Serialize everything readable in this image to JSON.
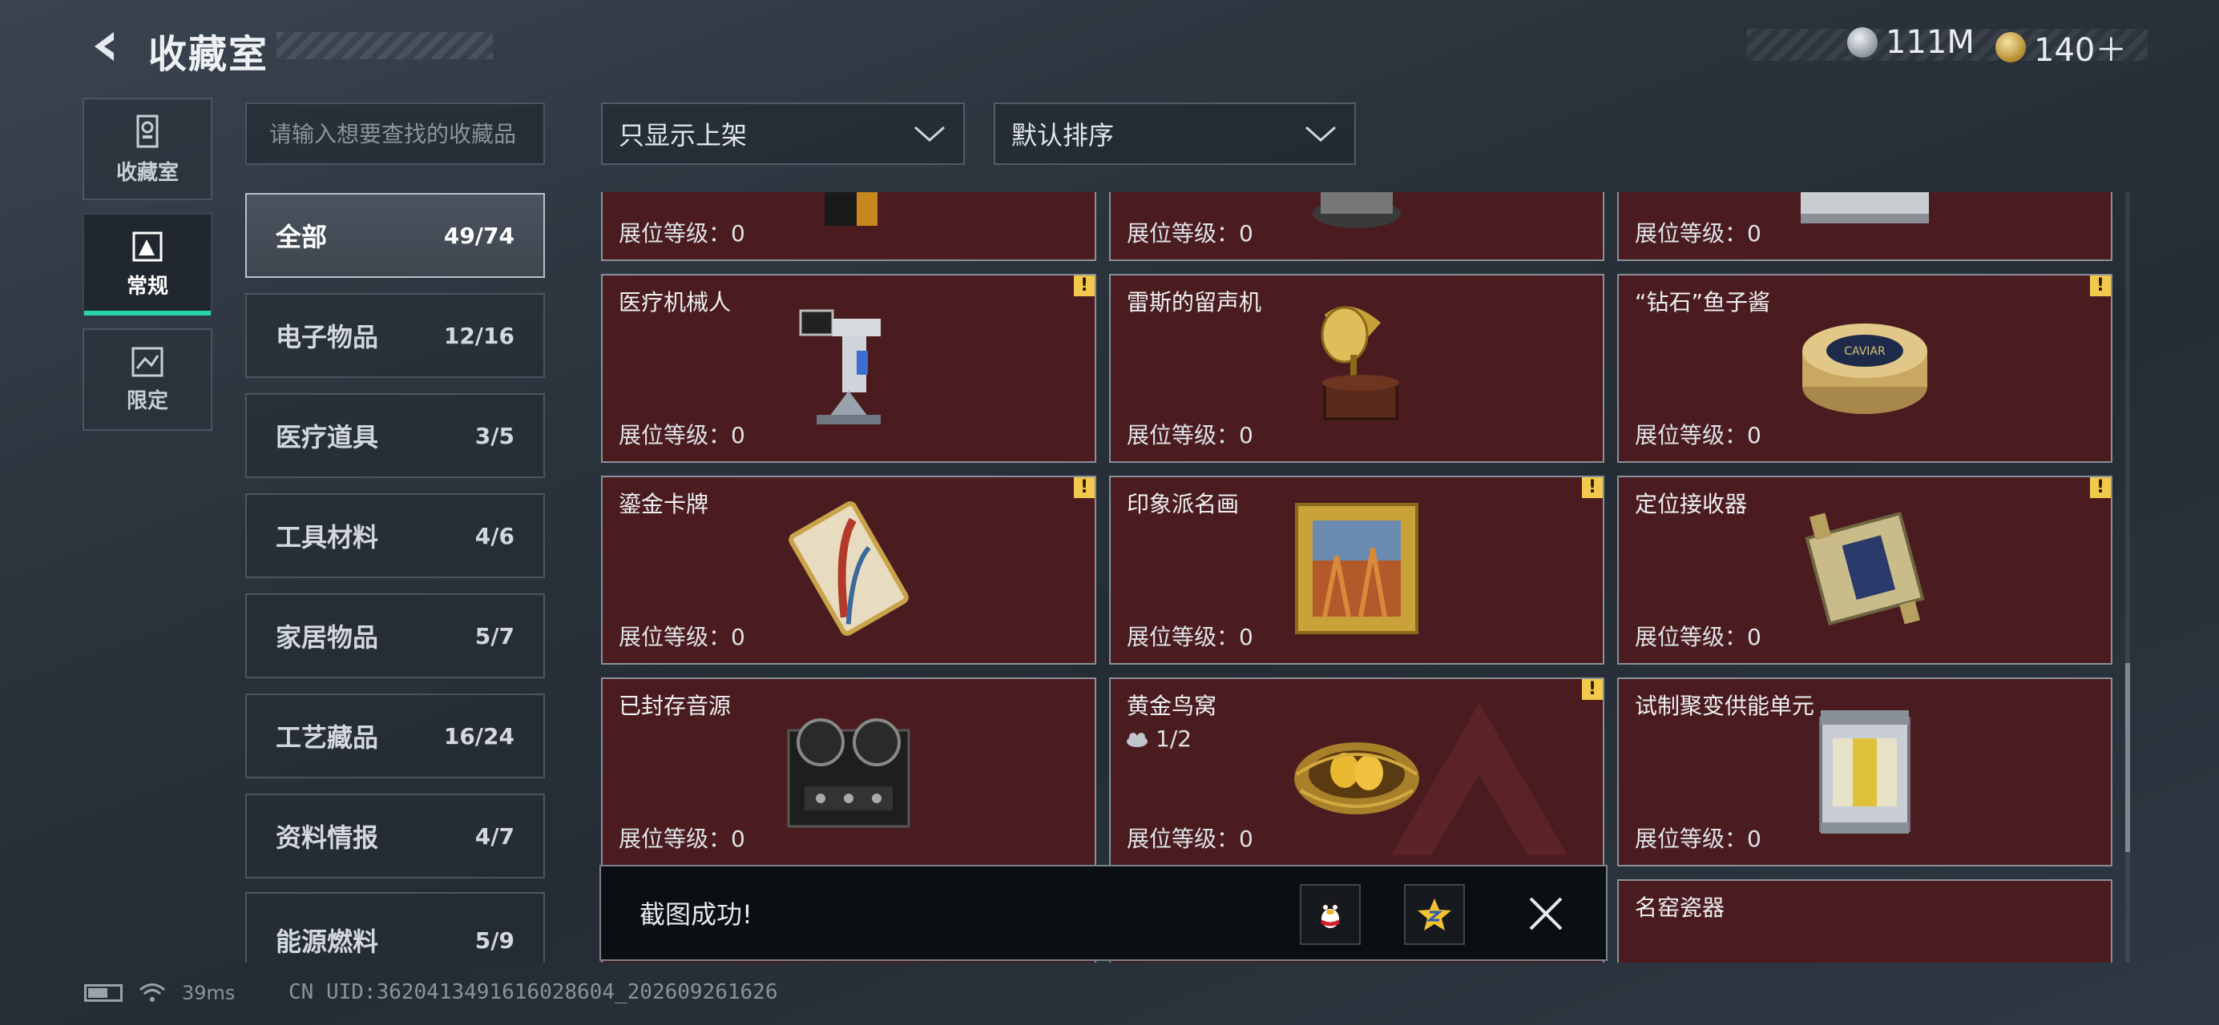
{
  "header": {
    "title": "收藏室",
    "currency1_value": "111M",
    "currency2_value": "140＋"
  },
  "side_tabs": [
    {
      "label": "收藏室",
      "icon": "trash-can-icon"
    },
    {
      "label": "常规",
      "icon": "document-icon"
    },
    {
      "label": "限定",
      "icon": "landscape-icon"
    }
  ],
  "search": {
    "placeholder": "请输入想要查找的收藏品"
  },
  "filters": {
    "display_filter": "只显示上架",
    "sort": "默认排序"
  },
  "categories": [
    {
      "label": "全部",
      "count": "49/74"
    },
    {
      "label": "电子物品",
      "count": "12/16"
    },
    {
      "label": "医疗道具",
      "count": "3/5"
    },
    {
      "label": "工具材料",
      "count": "4/6"
    },
    {
      "label": "家居物品",
      "count": "5/7"
    },
    {
      "label": "工艺藏品",
      "count": "16/24"
    },
    {
      "label": "资料情报",
      "count": "4/7"
    },
    {
      "label": "能源燃料",
      "count": "5/9"
    }
  ],
  "level_label": "展位等级：0",
  "items": [
    {
      "name": "",
      "warn": false
    },
    {
      "name": "",
      "warn": false
    },
    {
      "name": "",
      "warn": false
    },
    {
      "name": "医疗机械人",
      "warn": true
    },
    {
      "name": "雷斯的留声机",
      "warn": false
    },
    {
      "name": "“钻石”鱼子酱",
      "warn": true
    },
    {
      "name": "鎏金卡牌",
      "warn": true
    },
    {
      "name": "印象派名画",
      "warn": true
    },
    {
      "name": "定位接收器",
      "warn": true
    },
    {
      "name": "已封存音源",
      "warn": false
    },
    {
      "name": "黄金鸟窝",
      "warn": true,
      "sub": "1/2"
    },
    {
      "name": "试制聚变供能单元",
      "warn": false
    },
    {
      "name": "",
      "warn": false
    },
    {
      "name": "",
      "warn": false
    },
    {
      "name": "名窑瓷器",
      "warn": false
    }
  ],
  "warn_symbol": "!",
  "toast": {
    "message": "截图成功!"
  },
  "footer": {
    "ping": "39ms",
    "uid": "CN UID:3620413491616028604_202609261626"
  }
}
